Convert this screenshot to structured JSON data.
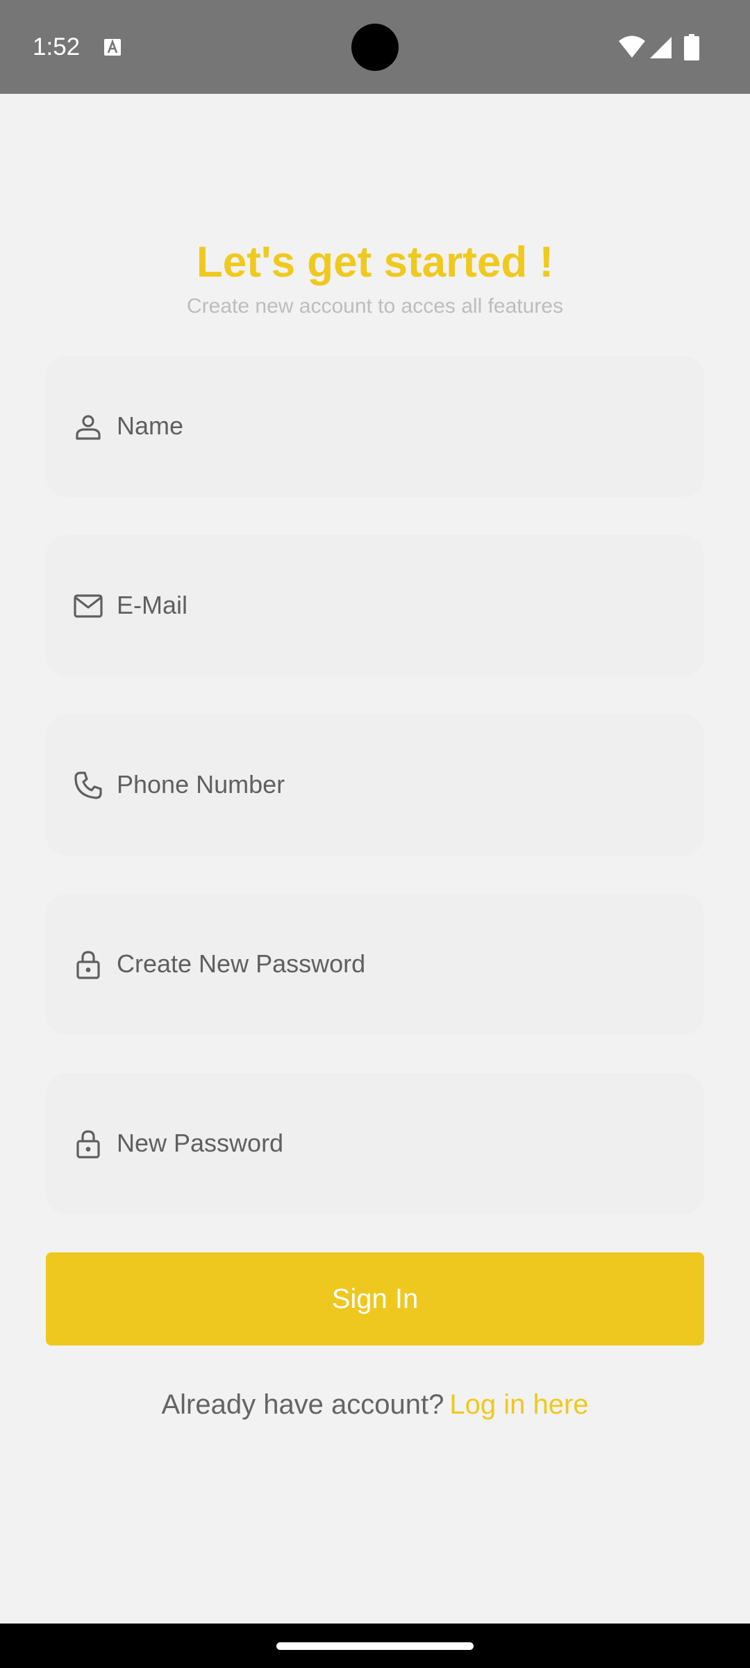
{
  "status_bar": {
    "time": "1:52",
    "icons": [
      "text-a-icon",
      "wifi-icon",
      "cellular-signal-icon",
      "battery-icon"
    ]
  },
  "header": {
    "title": "Let's get started !",
    "subtitle": "Create new account to acces all features"
  },
  "form": {
    "fields": [
      {
        "icon": "person-icon",
        "placeholder": "Name",
        "value": ""
      },
      {
        "icon": "mail-icon",
        "placeholder": "E-Mail",
        "value": ""
      },
      {
        "icon": "phone-icon",
        "placeholder": "Phone Number",
        "value": ""
      },
      {
        "icon": "lock-icon",
        "placeholder": "Create New Password",
        "value": ""
      },
      {
        "icon": "lock-icon",
        "placeholder": "New Password",
        "value": ""
      }
    ],
    "submit_label": "Sign In"
  },
  "footer": {
    "prompt": "Already have account?",
    "link": "Log in here"
  },
  "colors": {
    "accent": "#eec81e",
    "status_bar": "#767676",
    "background": "#f2f2f2",
    "field_background": "#efefef"
  }
}
